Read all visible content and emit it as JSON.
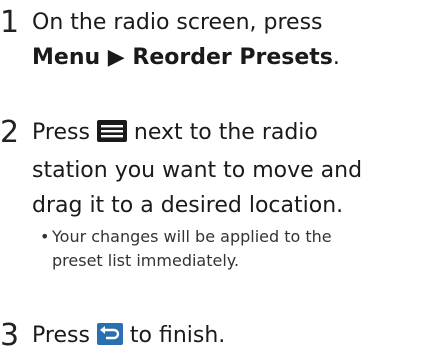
{
  "steps": [
    {
      "number": "1",
      "line1": "On the radio screen, press",
      "line2_bold": "Menu ▶ Reorder Presets",
      "line2_tail": "."
    },
    {
      "number": "2",
      "line1_pre": "Press",
      "line1_post": "next to the radio",
      "line1_icon": "list-menu-icon",
      "line2": "station you want to move and",
      "line3": "drag it to a desired location.",
      "sub_bullet": "•",
      "sub_line1": "Your changes will be applied to the",
      "sub_line2": "preset list immediately."
    },
    {
      "number": "3",
      "line1_pre": "Press",
      "line1_post": "to finish.",
      "line1_icon": "back-arrow-icon"
    }
  ],
  "colors": {
    "icon_fill": "#1a1a1a",
    "back_icon_fill": "#2a6fb0"
  }
}
